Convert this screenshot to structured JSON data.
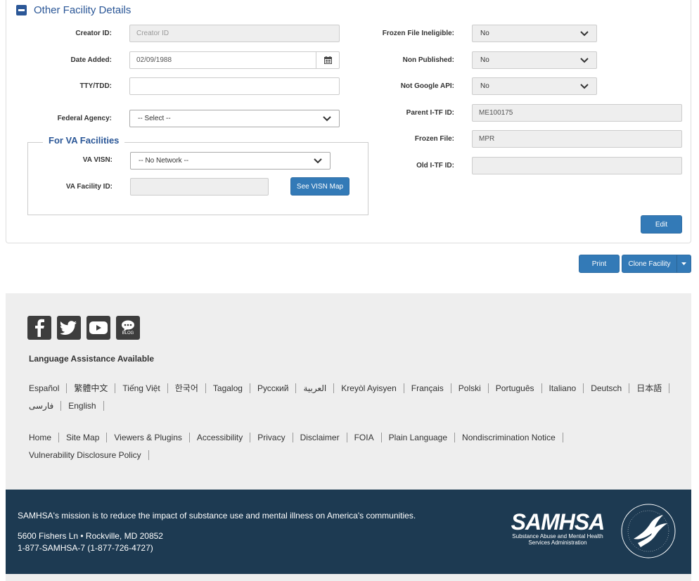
{
  "panel": {
    "title": "Other Facility Details",
    "creator_id": {
      "label": "Creator ID:",
      "placeholder": "Creator ID"
    },
    "date_added": {
      "label": "Date Added:",
      "value": "02/09/1988"
    },
    "tty": {
      "label": "TTY/TDD:",
      "value": ""
    },
    "federal_agency": {
      "label": "Federal Agency:",
      "value": "-- Select --"
    },
    "frozen_file_ineligible": {
      "label": "Frozen File Ineligible:",
      "value": "No"
    },
    "non_published": {
      "label": "Non Published:",
      "value": "No"
    },
    "not_google_api": {
      "label": "Not Google API:",
      "value": "No"
    },
    "parent_itf_id": {
      "label": "Parent I-TF ID:",
      "value": "ME100175"
    },
    "frozen_file": {
      "label": "Frozen File:",
      "value": "MPR"
    },
    "old_itf_id": {
      "label": "Old I-TF ID:",
      "value": ""
    },
    "va": {
      "legend": "For VA Facilities",
      "visn_label": "VA VISN:",
      "visn_value": "-- No Network --",
      "facility_id_label": "VA Facility ID:",
      "facility_id_value": "",
      "see_visn_map": "See VISN Map"
    },
    "edit": "Edit"
  },
  "actions": {
    "print": "Print",
    "clone": "Clone Facility"
  },
  "footer": {
    "language_heading": "Language Assistance Available",
    "languages": [
      "Español",
      "繁體中文",
      "Tiếng Việt",
      "한국어",
      "Tagalog",
      "Русский",
      "العربية",
      "Kreyòl Ayisyen",
      "Français",
      "Polski",
      "Português",
      "Italiano",
      "Deutsch",
      "日本語",
      "فارسی",
      "English"
    ],
    "site_links": [
      "Home",
      "Site Map",
      "Viewers & Plugins",
      "Accessibility",
      "Privacy",
      "Disclaimer",
      "FOIA",
      "Plain Language",
      "Nondiscrimination Notice",
      "Vulnerability Disclosure Policy"
    ],
    "blog_label": "BLOG"
  },
  "bottom": {
    "mission": "SAMHSA's mission is to reduce the impact of substance use and mental illness on America's communities.",
    "address": "5600 Fishers Ln • Rockville, MD 20852",
    "phone": "1-877-SAMHSA-7 (1-877-726-4727)",
    "logo_text": "SAMHSA",
    "logo_sub1": "Substance Abuse and Mental Health",
    "logo_sub2": "Services Administration"
  },
  "colors": {
    "primary": "#337ab7",
    "title_blue": "#2b5797",
    "footer_dark": "#1d3a52",
    "footer_light": "#eeeeee"
  }
}
